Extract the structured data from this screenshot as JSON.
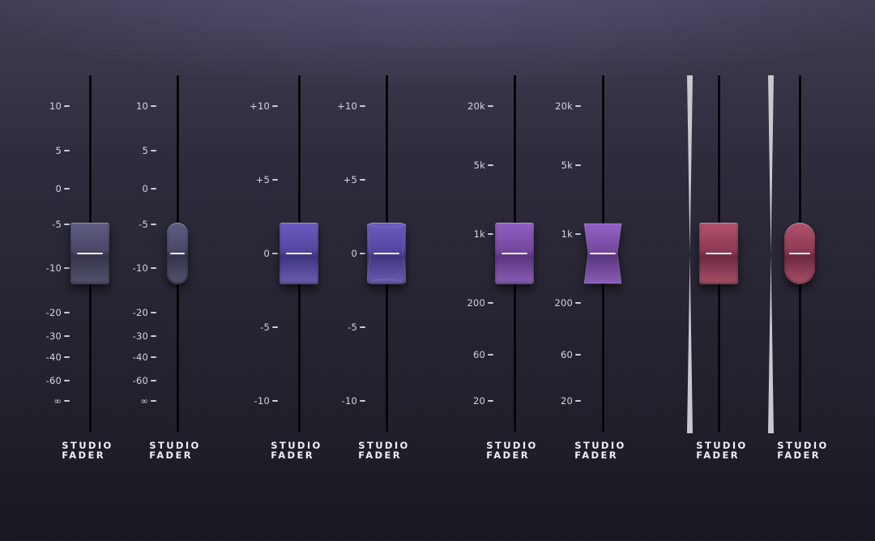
{
  "faders": [
    {
      "id": "f1",
      "label_top": "STUDIO",
      "label_bottom": "FADER",
      "cap_style": "rect",
      "color": "#4a4868",
      "scale": [
        "10",
        "5",
        "0",
        "-5",
        "-10",
        "-20",
        "-30",
        "-40",
        "-60",
        "∞"
      ],
      "value": "-8"
    },
    {
      "id": "f2",
      "label_top": "STUDIO",
      "label_bottom": "FADER",
      "cap_style": "pill",
      "color": "#4a4868",
      "scale": [
        "10",
        "5",
        "0",
        "-5",
        "-10",
        "-20",
        "-30",
        "-40",
        "-60",
        "∞"
      ],
      "value": "-8"
    },
    {
      "id": "f3",
      "label_top": "STUDIO",
      "label_bottom": "FADER",
      "cap_style": "rect",
      "color": "#5348a0",
      "scale": [
        "+10",
        "+5",
        "0",
        "-5",
        "-10"
      ],
      "value": "0"
    },
    {
      "id": "f4",
      "label_top": "STUDIO",
      "label_bottom": "FADER",
      "cap_style": "curved",
      "color": "#5348a0",
      "scale": [
        "+10",
        "+5",
        "0",
        "-5",
        "-10"
      ],
      "value": "0"
    },
    {
      "id": "f5",
      "label_top": "STUDIO",
      "label_bottom": "FADER",
      "cap_style": "rect",
      "color": "#74489f",
      "scale": [
        "20k",
        "5k",
        "1k",
        "200",
        "60",
        "20"
      ],
      "value": "500"
    },
    {
      "id": "f6",
      "label_top": "STUDIO",
      "label_bottom": "FADER",
      "cap_style": "hourglass",
      "color": "#74489f",
      "scale": [
        "20k",
        "5k",
        "1k",
        "200",
        "60",
        "20"
      ],
      "value": "500"
    },
    {
      "id": "f7",
      "label_top": "STUDIO",
      "label_bottom": "FADER",
      "cap_style": "rect",
      "color": "#8e3a54",
      "scale": [],
      "value": null
    },
    {
      "id": "f8",
      "label_top": "STUDIO",
      "label_bottom": "FADER",
      "cap_style": "pill",
      "color": "#8e3a54",
      "scale": [],
      "value": null
    }
  ],
  "scale_indicator_color": "#cfcbd9"
}
